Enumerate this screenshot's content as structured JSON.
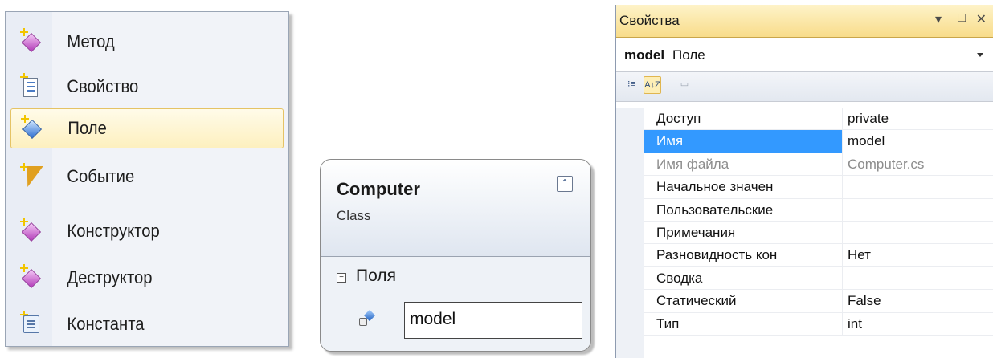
{
  "menu": {
    "items": [
      {
        "label": "Метод",
        "icon": "method-icon"
      },
      {
        "label": "Свойство",
        "icon": "property-icon"
      },
      {
        "label": "Поле",
        "icon": "field-icon",
        "selected": true
      },
      {
        "label": "Событие",
        "icon": "event-icon"
      },
      {
        "label": "Конструктор",
        "icon": "constructor-icon"
      },
      {
        "label": "Деструктор",
        "icon": "destructor-icon"
      },
      {
        "label": "Константа",
        "icon": "constant-icon"
      }
    ]
  },
  "class_shape": {
    "name": "Computer",
    "kind": "Class",
    "collapse_glyph": "⌃",
    "section_toggle": "−",
    "section_label": "Поля",
    "field_value": "model"
  },
  "properties": {
    "title": "Свойства",
    "controls": {
      "dropdown": "▾",
      "maximize": "□",
      "close": "✕"
    },
    "selector_name": "model",
    "selector_kind": "Поле",
    "toolbar": {
      "categorized": "⁝≡",
      "alphabetical": "A↓Z",
      "pages": "▭"
    },
    "rows": [
      {
        "key": "Доступ",
        "value": "private"
      },
      {
        "key": "Имя",
        "value": "model",
        "selected": true
      },
      {
        "key": "Имя файла",
        "value": "Computer.cs",
        "disabled": true
      },
      {
        "key": "Начальное значен",
        "value": ""
      },
      {
        "key": "Пользовательские",
        "value": ""
      },
      {
        "key": "Примечания",
        "value": ""
      },
      {
        "key": "Разновидность кон",
        "value": "Нет"
      },
      {
        "key": "Сводка",
        "value": ""
      },
      {
        "key": "Статический",
        "value": "False"
      },
      {
        "key": "Тип",
        "value": "int"
      }
    ]
  },
  "colors": {
    "selection": "#3399ff",
    "menu_highlight": "#fdf0bf",
    "title_bar": "#f8dc8a"
  }
}
